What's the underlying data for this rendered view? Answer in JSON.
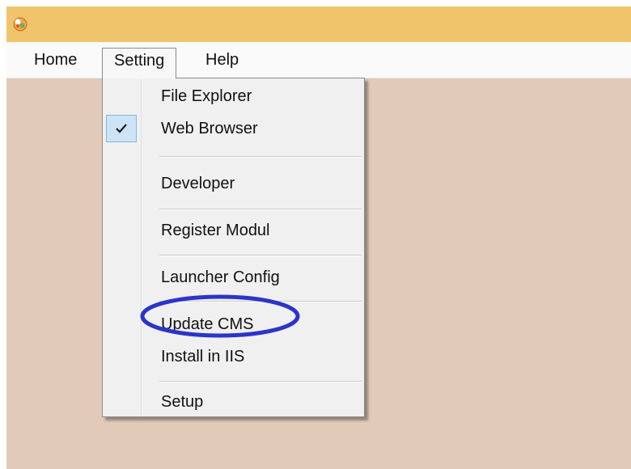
{
  "menubar": {
    "home": "Home",
    "setting": "Setting",
    "help": "Help"
  },
  "setting_menu": {
    "items": [
      {
        "label": "File Explorer",
        "checked": false
      },
      {
        "label": "Web Browser",
        "checked": true
      },
      {
        "label": "Developer",
        "checked": false
      },
      {
        "label": "Register Modul",
        "checked": false
      },
      {
        "label": "Launcher Config",
        "checked": false
      },
      {
        "label": "Update CMS",
        "checked": false
      },
      {
        "label": "Install in IIS",
        "checked": false
      },
      {
        "label": "Setup",
        "checked": false
      }
    ]
  },
  "colors": {
    "titlebar": "#f0c46a",
    "window_background": "#e2cab9",
    "annotation": "#2b35c8",
    "check_highlight": "#cde4f7"
  },
  "icons": {
    "app": "app-logo-icon",
    "check": "checkmark-icon"
  }
}
